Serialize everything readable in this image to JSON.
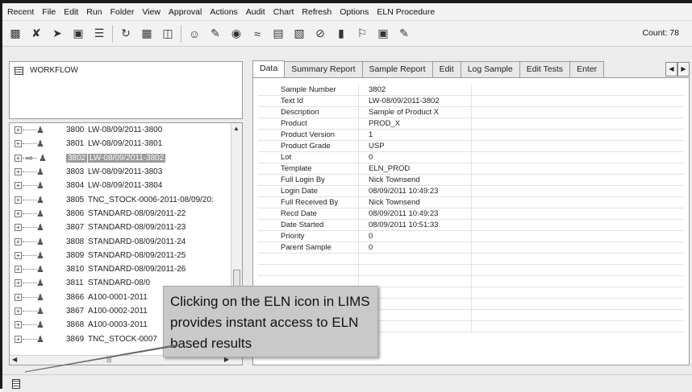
{
  "menu": [
    "Recent",
    "File",
    "Edit",
    "Run",
    "Folder",
    "View",
    "Approval",
    "Actions",
    "Audit",
    "Chart",
    "Refresh",
    "Options",
    "ELN Procedure"
  ],
  "toolbar": {
    "icons": [
      "login-icon",
      "tools-icon",
      "forward-icon",
      "save-icon",
      "stack-icon",
      "refresh-icon",
      "grid-icon",
      "network-icon",
      "users-icon",
      "edit-icon",
      "globe-icon",
      "chart-icon",
      "database-icon",
      "report-icon",
      "stop-icon",
      "barcode-icon",
      "flag-icon",
      "image-icon",
      "notes-icon"
    ],
    "count": "Count: 78"
  },
  "workflow": {
    "label": "WORKFLOW"
  },
  "tree": {
    "items": [
      {
        "sid": "3800",
        "tid": "LW-08/09/2011-3800"
      },
      {
        "sid": "3801",
        "tid": "LW-08/09/2011-3801"
      },
      {
        "sid": "3802",
        "tid": "LW-08/09/2011-3802",
        "selected": true
      },
      {
        "sid": "3803",
        "tid": "LW-08/09/2011-3803"
      },
      {
        "sid": "3804",
        "tid": "LW-08/09/2011-3804"
      },
      {
        "sid": "3805",
        "tid": "TNC_STOCK-0006-2011-08/09/20:"
      },
      {
        "sid": "3806",
        "tid": "STANDARD-08/09/2011-22"
      },
      {
        "sid": "3807",
        "tid": "STANDARD-08/09/2011-23"
      },
      {
        "sid": "3808",
        "tid": "STANDARD-08/09/2011-24"
      },
      {
        "sid": "3809",
        "tid": "STANDARD-08/09/2011-25"
      },
      {
        "sid": "3810",
        "tid": "STANDARD-08/09/2011-26"
      },
      {
        "sid": "3811",
        "tid": "STANDARD-08/0"
      },
      {
        "sid": "3866",
        "tid": "A100-0001-2011"
      },
      {
        "sid": "3867",
        "tid": "A100-0002-2011"
      },
      {
        "sid": "3868",
        "tid": "A100-0003-2011"
      },
      {
        "sid": "3869",
        "tid": "TNC_STOCK-0007"
      }
    ]
  },
  "tabs": [
    "Data",
    "Summary Report",
    "Sample Report",
    "Edit",
    "Log Sample",
    "Edit Tests",
    "Enter"
  ],
  "grid": [
    {
      "label": "Sample Number",
      "value": "3802"
    },
    {
      "label": "Text Id",
      "value": "LW-08/09/2011-3802"
    },
    {
      "label": "Description",
      "value": "Sample of Product X"
    },
    {
      "label": "Product",
      "value": "PROD_X"
    },
    {
      "label": "Product Version",
      "value": "1"
    },
    {
      "label": "Product Grade",
      "value": "USP"
    },
    {
      "label": "Lot",
      "value": "0"
    },
    {
      "label": "Template",
      "value": "ELN_PROD"
    },
    {
      "label": "Full Login By",
      "value": "Nick Townsend"
    },
    {
      "label": "Login Date",
      "value": "08/09/2011 10:49:23"
    },
    {
      "label": "Full Received By",
      "value": "Nick Townsend"
    },
    {
      "label": "Recd Date",
      "value": "08/09/2011 10:49:23"
    },
    {
      "label": "Date Started",
      "value": "08/09/2011 10:51:33"
    },
    {
      "label": "Priority",
      "value": "0"
    },
    {
      "label": "Parent Sample",
      "value": "0"
    },
    {
      "label": "",
      "value": ""
    },
    {
      "label": "",
      "value": ""
    },
    {
      "label": "",
      "value": ""
    },
    {
      "label": "",
      "value": ""
    },
    {
      "label": "",
      "value": ""
    },
    {
      "label": "",
      "value": ""
    },
    {
      "label": "",
      "value": ""
    }
  ],
  "callout": {
    "lines": [
      "Clicking on the ELN icon in LIMS",
      "provides instant access to ELN",
      "based results"
    ]
  }
}
